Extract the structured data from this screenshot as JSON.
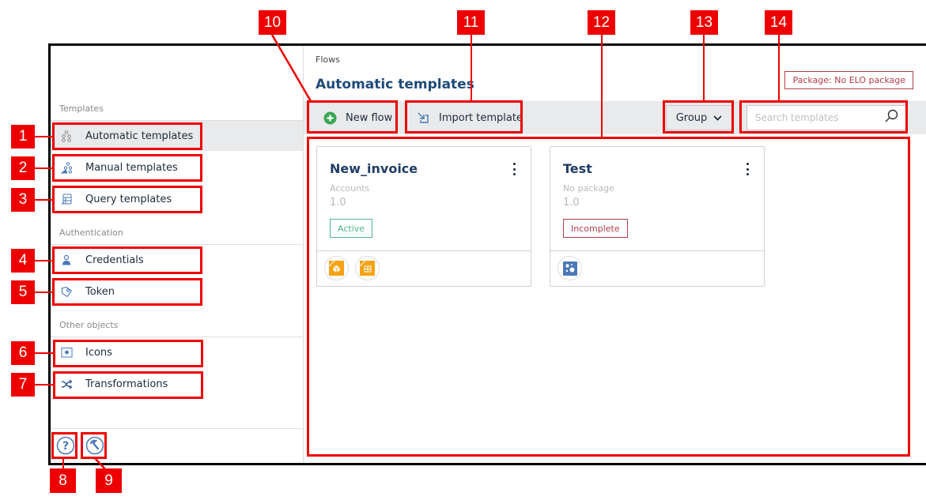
{
  "sidebar": {
    "sections": [
      {
        "label": "Templates",
        "items": [
          {
            "label": "Automatic templates",
            "icon": "flow-nodes-icon",
            "active": true
          },
          {
            "label": "Manual templates",
            "icon": "manual-flow-icon",
            "active": false
          },
          {
            "label": "Query templates",
            "icon": "database-query-icon",
            "active": false
          }
        ]
      },
      {
        "label": "Authentication",
        "items": [
          {
            "label": "Credentials",
            "icon": "user-icon",
            "active": false
          },
          {
            "label": "Token",
            "icon": "tag-token-icon",
            "active": false
          }
        ]
      },
      {
        "label": "Other objects",
        "items": [
          {
            "label": "Icons",
            "icon": "image-icon",
            "active": false
          },
          {
            "label": "Transformations",
            "icon": "shuffle-icon",
            "active": false
          }
        ]
      }
    ],
    "footer": {
      "help_icon": "help-circle-icon",
      "tools_icon": "wrench-circle-icon"
    }
  },
  "header": {
    "breadcrumb": "Flows",
    "title": "Automatic templates",
    "package_badge": "Package: No ELO package"
  },
  "toolbar": {
    "new_flow_label": "New flow",
    "import_label": "Import template",
    "group_label": "Group",
    "search_placeholder": "Search templates",
    "search_value": ""
  },
  "cards": [
    {
      "title": "New_invoice",
      "package": "Accounts",
      "version": "1.0",
      "status": "Active",
      "status_color": "#4cb889",
      "icons": [
        "package-box-icon",
        "table-grid-icon"
      ]
    },
    {
      "title": "Test",
      "package": "No package",
      "version": "1.0",
      "status": "Incomplete",
      "status_color": "#b23b4b",
      "icons": [
        "dots-cluster-icon"
      ]
    }
  ],
  "colors": {
    "accent": "#1e4a7a",
    "callout": "#ee0000",
    "active_bg": "#e9eaec",
    "new_flow_icon": "#3aa655",
    "orange_icon": "#f5a315",
    "blue_icon": "#4a79b8"
  },
  "callouts": [
    "1",
    "2",
    "3",
    "4",
    "5",
    "6",
    "7",
    "8",
    "9",
    "10",
    "11",
    "12",
    "13",
    "14"
  ]
}
